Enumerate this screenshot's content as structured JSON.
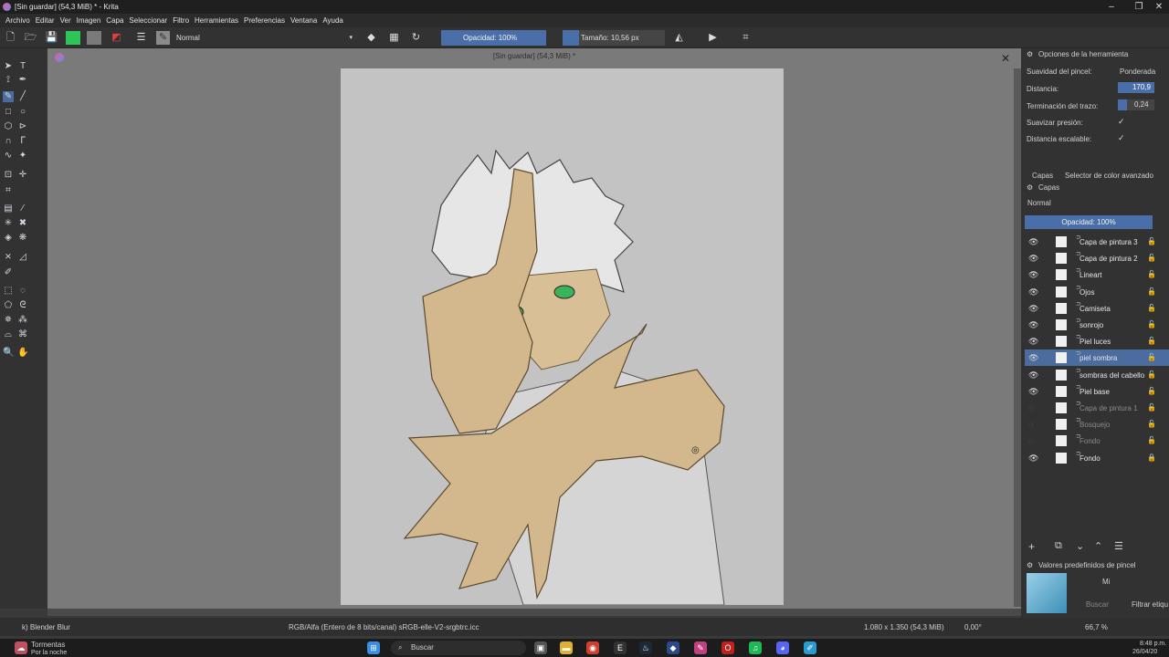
{
  "window": {
    "title": "[Sin guardar]  (54,3 MiB) * - Krita"
  },
  "menu": [
    "Archivo",
    "Editar",
    "Ver",
    "Imagen",
    "Capa",
    "Seleccionar",
    "Filtro",
    "Herramientas",
    "Preferencias",
    "Ventana",
    "Ayuda"
  ],
  "toolbar": {
    "blend_mode": "Normal",
    "opacity": "Opacidad: 100%",
    "size": "Tamaño: 10,56 px",
    "fg_color": "#2ec45a",
    "bg_color": "#7a7a7a"
  },
  "document": {
    "title": "[Sin guardar]  (54,3 MiB) *"
  },
  "tool_options": {
    "header": "Opciones de la herramienta",
    "rows": [
      {
        "label": "Suavidad del pincel:",
        "value": "Ponderada"
      },
      {
        "label": "Distancia:",
        "value": "170,9"
      },
      {
        "label": "Terminación del trazo:",
        "value": "0,24"
      },
      {
        "label": "Suavizar presión:",
        "value": "✓"
      },
      {
        "label": "Distancia escalable:",
        "value": "✓"
      }
    ]
  },
  "layers_panel": {
    "tabs": [
      "Capas",
      "Selector de color avanzado"
    ],
    "header": "Capas",
    "blend_mode": "Normal",
    "opacity": "Opacidad:  100%",
    "layers": [
      {
        "name": "Capa de pintura 3",
        "visible": true
      },
      {
        "name": "Capa de pintura 2",
        "visible": true
      },
      {
        "name": "Lineart",
        "visible": true
      },
      {
        "name": "Ojos",
        "visible": true
      },
      {
        "name": "Camiseta",
        "visible": true
      },
      {
        "name": "sonrojo",
        "visible": true
      },
      {
        "name": "Piel luces",
        "visible": true
      },
      {
        "name": "piel sombra",
        "visible": true,
        "selected": true
      },
      {
        "name": "sombras del cabello",
        "visible": true
      },
      {
        "name": "Piel base",
        "visible": true
      },
      {
        "name": "Capa de pintura 1",
        "visible": false
      },
      {
        "name": "Bosquejo",
        "visible": false
      },
      {
        "name": "Fondo",
        "visible": false
      },
      {
        "name": "Fondo",
        "visible": true,
        "locked": true
      }
    ]
  },
  "brush_presets": {
    "header": "Valores predefinidos de pincel",
    "tag": "Mi",
    "search_placeholder": "Buscar",
    "filter_label": "Filtrar etiqu"
  },
  "statusbar": {
    "brush": "k) Blender Blur",
    "color_space": "RGB/Alfa (Entero de 8 bits/canal)  sRGB-elle-V2-srgbtrc.icc",
    "dimensions": "1.080 x 1.350 (54,3 MiB)",
    "rotation": "0,00°",
    "zoom": "66,7 %"
  },
  "taskbar": {
    "weather_title": "Tormentas",
    "weather_sub": "Por la noche",
    "search": "Buscar",
    "time": "8:48 p.m.",
    "date": "26/04/20"
  }
}
